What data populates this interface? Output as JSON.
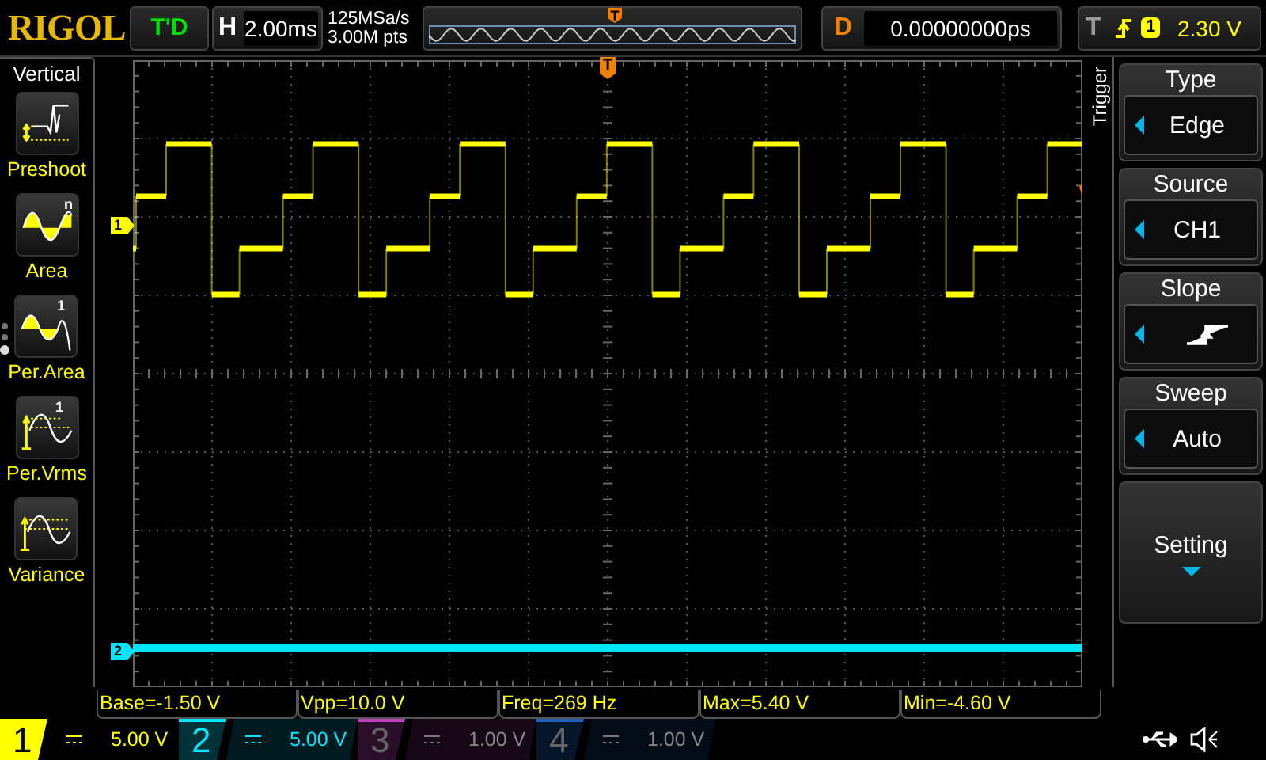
{
  "top_bar": {
    "brand": "RIGOL",
    "run_status": "T'D",
    "horizontal": {
      "label": "H",
      "scale": "2.00ms"
    },
    "acquisition": {
      "sample_rate": "125MSa/s",
      "memory_depth": "3.00M pts"
    },
    "overview": {
      "trigger_label": "T"
    },
    "delay": {
      "label": "D",
      "value": "0.00000000ps"
    },
    "trigger": {
      "label": "T",
      "source": "1",
      "level": "2.30 V"
    }
  },
  "left_menu": {
    "title": "Vertical",
    "items": [
      {
        "kind": "preshoot",
        "label": "Preshoot"
      },
      {
        "kind": "area",
        "label": "Area",
        "mark": "n"
      },
      {
        "kind": "per_area",
        "label": "Per.Area",
        "mark": "1"
      },
      {
        "kind": "per_vrms",
        "label": "Per.Vrms",
        "mark": "1"
      },
      {
        "kind": "variance",
        "label": "Variance"
      }
    ],
    "pages": [
      {
        "selected": false
      },
      {
        "selected": false
      },
      {
        "selected": true
      }
    ]
  },
  "screen": {
    "trigger_position_label": "T",
    "markers": [
      {
        "label": "1"
      },
      {
        "label": "2"
      }
    ]
  },
  "right_menu": {
    "side_label": "Trigger",
    "items": [
      {
        "kind": "select",
        "title": "Type",
        "value": "Edge"
      },
      {
        "kind": "select",
        "title": "Source",
        "value": "CH1"
      },
      {
        "kind": "slope",
        "title": "Slope"
      },
      {
        "kind": "select",
        "title": "Sweep",
        "value": "Auto"
      },
      {
        "kind": "submenu",
        "title": "Setting"
      }
    ]
  },
  "measurements": [
    "Base=-1.50 V",
    "Vpp=10.0 V",
    "Freq=269 Hz",
    "Max=5.40 V",
    "Min=-4.60 V"
  ],
  "channels": [
    {
      "number": "1",
      "scale": "5.00 V",
      "on": true,
      "selected": true,
      "color": "#ffff00"
    },
    {
      "number": "2",
      "scale": "5.00 V",
      "on": true,
      "selected": false,
      "color": "#00e5ff"
    },
    {
      "number": "3",
      "scale": "1.00 V",
      "on": false,
      "selected": false,
      "color": "#c040c0"
    },
    {
      "number": "4",
      "scale": "1.00 V",
      "on": false,
      "selected": false,
      "color": "#2060c0"
    }
  ]
}
